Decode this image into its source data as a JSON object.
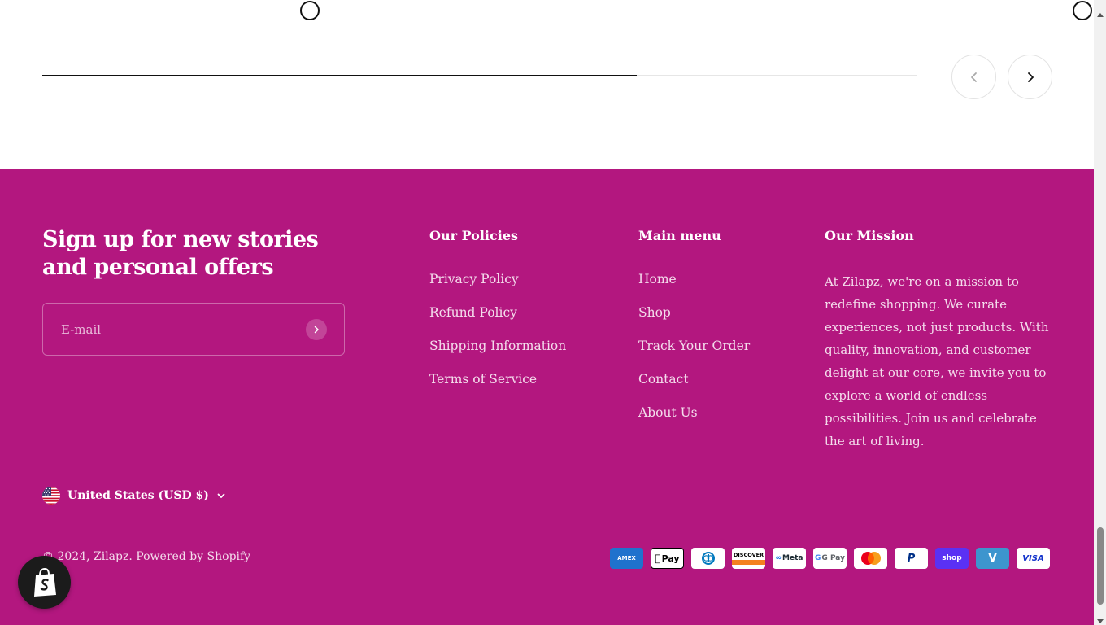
{
  "carousel": {
    "progress": 0.68
  },
  "signup": {
    "title": "Sign up for new stories and personal offers",
    "email_placeholder": "E-mail"
  },
  "policies": {
    "title": "Our Policies",
    "items": [
      {
        "label": "Privacy Policy"
      },
      {
        "label": "Refund Policy"
      },
      {
        "label": "Shipping Information"
      },
      {
        "label": "Terms of Service"
      }
    ]
  },
  "main_menu": {
    "title": "Main menu",
    "items": [
      {
        "label": "Home"
      },
      {
        "label": "Shop"
      },
      {
        "label": "Track Your Order"
      },
      {
        "label": "Contact"
      },
      {
        "label": "About Us"
      }
    ]
  },
  "mission": {
    "title": "Our Mission",
    "text": "At Zilapz, we're on a mission to redefine shopping. We curate experiences, not just products. With quality, innovation, and customer delight at our core, we invite you to explore a world of endless possibilities. Join us and celebrate the art of living."
  },
  "country_selector": {
    "label": "United States (USD $)",
    "flag_icon": "us-flag-icon"
  },
  "copyright": {
    "prefix": "© 2024, ",
    "store_name": "Zilapz",
    "separator": ". ",
    "powered_by": "Powered by Shopify"
  },
  "payments": [
    {
      "name": "American Express",
      "label": "AMEX",
      "icon": "amex-icon"
    },
    {
      "name": "Apple Pay",
      "label": "Pay",
      "icon": "apple-pay-icon"
    },
    {
      "name": "Diners Club",
      "label": "",
      "icon": "diners-club-icon"
    },
    {
      "name": "Discover",
      "label": "DISCOVER",
      "icon": "discover-icon"
    },
    {
      "name": "Meta Pay",
      "label": "Meta",
      "icon": "meta-pay-icon"
    },
    {
      "name": "Google Pay",
      "label": "G Pay",
      "icon": "google-pay-icon"
    },
    {
      "name": "Mastercard",
      "label": "",
      "icon": "mastercard-icon"
    },
    {
      "name": "PayPal",
      "label": "P",
      "icon": "paypal-icon"
    },
    {
      "name": "Shop Pay",
      "label": "shop",
      "icon": "shop-pay-icon"
    },
    {
      "name": "Venmo",
      "label": "V",
      "icon": "venmo-icon"
    },
    {
      "name": "Visa",
      "label": "VISA",
      "icon": "visa-icon"
    }
  ],
  "colors": {
    "footer_bg": "#b3177f",
    "text": "#ffffff"
  }
}
